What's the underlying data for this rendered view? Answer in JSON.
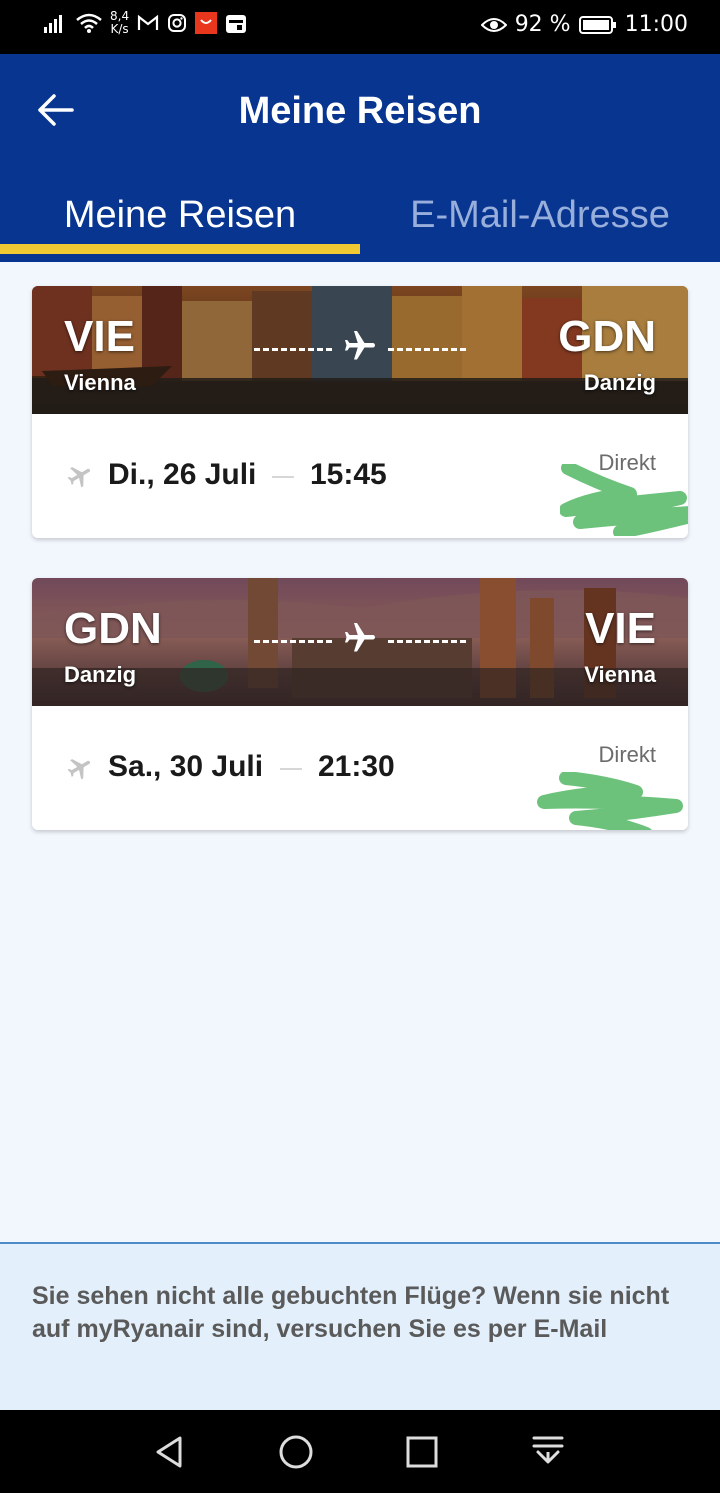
{
  "status_bar": {
    "speed_value": "8,4",
    "speed_unit": "K/s",
    "battery": "92 %",
    "time": "11:00"
  },
  "header": {
    "title": "Meine Reisen",
    "tabs": [
      {
        "label": "Meine Reisen",
        "active": true
      },
      {
        "label": "E-Mail-Adresse",
        "active": false
      }
    ]
  },
  "trips": [
    {
      "from_code": "VIE",
      "from_city": "Vienna",
      "to_code": "GDN",
      "to_city": "Danzig",
      "date": "Di., 26 Juli",
      "time": "15:45",
      "type": "Direkt"
    },
    {
      "from_code": "GDN",
      "from_city": "Danzig",
      "to_code": "VIE",
      "to_city": "Vienna",
      "date": "Sa., 30 Juli",
      "time": "21:30",
      "type": "Direkt"
    }
  ],
  "footer": {
    "text": "Sie sehen nicht alle gebuchten Flüge? Wenn sie nicht auf myRyanair sind, versuchen Sie es per E-Mail"
  },
  "colors": {
    "brand_blue": "#073590",
    "accent_yellow": "#f1c933",
    "scribble_green": "#6cc27b"
  }
}
